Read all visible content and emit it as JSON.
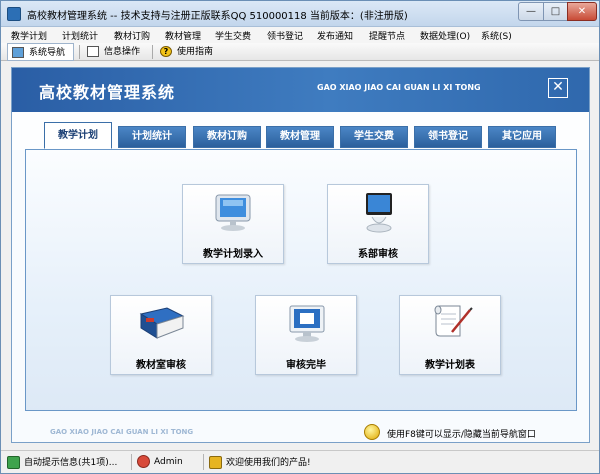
{
  "window": {
    "title": "高校教材管理系统 -- 技术支持与注册正版联系QQ 510000118    当前版本：(非注册版)",
    "minimize": "—",
    "maximize": "□",
    "close": "✕"
  },
  "menu": [
    "教学计划",
    "计划统计",
    "教材订购",
    "教材管理",
    "学生交费",
    "领书登记",
    "发布通知",
    "提醒节点",
    "数据处理(O)",
    "系统(S)"
  ],
  "toolbar": {
    "nav": "系统导航",
    "info": "信息操作",
    "help": "使用指南"
  },
  "main": {
    "title": "高校教材管理系统",
    "pinyin": "GAO XIAO JIAO CAI GUAN LI XI TONG",
    "close": "✕",
    "footer_pinyin": "GAO XIAO JIAO CAI GUAN LI XI TONG",
    "hint": "使用F8键可以显示/隐藏当前导航窗口"
  },
  "tabs": [
    "教学计划",
    "计划统计",
    "教材订购",
    "教材管理",
    "学生交费",
    "领书登记",
    "其它应用"
  ],
  "tiles": [
    {
      "label": "教学计划录入",
      "icon": "monitor-icon"
    },
    {
      "label": "系部审核",
      "icon": "imac-icon"
    },
    {
      "label": "教材室审核",
      "icon": "book-icon"
    },
    {
      "label": "审核完毕",
      "icon": "screen-icon"
    },
    {
      "label": "教学计划表",
      "icon": "document-icon"
    }
  ],
  "status": {
    "info": "自动提示信息(共1项)...",
    "user": "Admin",
    "welcome": "欢迎使用我们的产品!"
  }
}
